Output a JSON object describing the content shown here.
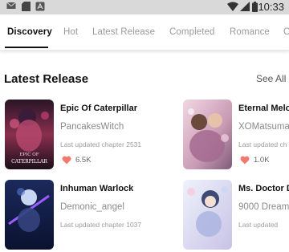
{
  "status_bar": {
    "time": "10:33",
    "icons": [
      "mail-icon",
      "sd-card-icon",
      "app-notification-icon",
      "wifi-icon",
      "signal-icon",
      "battery-icon"
    ]
  },
  "tabs": [
    {
      "label": "Discovery",
      "active": true
    },
    {
      "label": "Hot",
      "active": false
    },
    {
      "label": "Latest Release",
      "active": false
    },
    {
      "label": "Completed",
      "active": false
    },
    {
      "label": "Romance",
      "active": false
    },
    {
      "label": "C",
      "active": false
    }
  ],
  "section": {
    "title": "Latest Release",
    "see_all": "See All"
  },
  "books": [
    {
      "title": "Epic Of Caterpillar",
      "author": "PancakesWitch",
      "updated": "Last updated chapter 2531",
      "likes": "6.5K",
      "cover_text_1": "EPIC OF",
      "cover_text_2": "CATERPILLAR"
    },
    {
      "title": "Eternal Melo",
      "author": "XOMatsuma",
      "updated": "Last updated ch",
      "likes": "1.0K",
      "cover_text_1": "",
      "cover_text_2": ""
    },
    {
      "title": "Inhuman Warlock",
      "author": "Demonic_angel",
      "updated": "Last updated chapter 1037",
      "likes": "",
      "cover_text_1": "",
      "cover_text_2": ""
    },
    {
      "title": "Ms. Doctor D",
      "author": "9000 Dream",
      "updated": "Last updated",
      "likes": "",
      "cover_text_1": "",
      "cover_text_2": ""
    }
  ],
  "colors": {
    "heart": "#f07a70",
    "active_tab": "#111111",
    "inactive_tab": "#9a9a9a"
  }
}
